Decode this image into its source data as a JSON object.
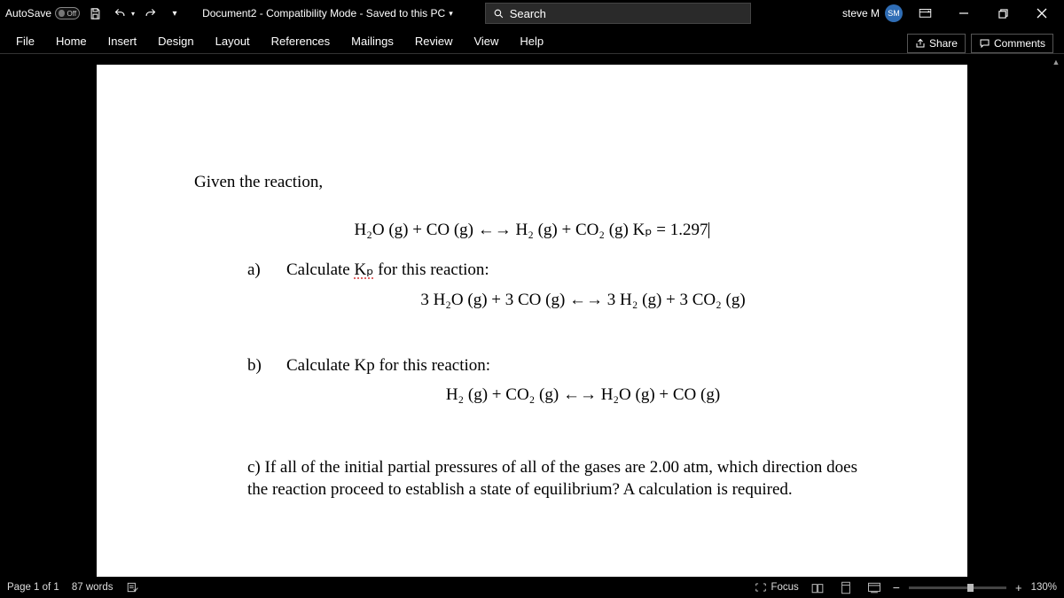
{
  "titlebar": {
    "autosave_label": "AutoSave",
    "autosave_state": "Off",
    "doc_title": "Document2 - Compatibility Mode - Saved to this PC",
    "search_placeholder": "Search",
    "user_name": "steve M",
    "user_initials": "SM"
  },
  "tabs": {
    "file": "File",
    "home": "Home",
    "insert": "Insert",
    "design": "Design",
    "layout": "Layout",
    "references": "References",
    "mailings": "Mailings",
    "review": "Review",
    "view": "View",
    "help": "Help",
    "share": "Share",
    "comments": "Comments"
  },
  "doc": {
    "intro": "Given the reaction,",
    "eq_main_pre": "H",
    "eq_main": "H₂O (g) + CO (g) ←→ H₂ (g) + CO₂ (g)   Kₚ = 1.297",
    "a_label": "a)",
    "a_text_pre": "Calculate ",
    "a_kp": "Kₚ",
    "a_text_post": " for this reaction:",
    "eq_a": "3 H₂O (g) + 3 CO (g) ←→ 3 H₂ (g) + 3 CO₂ (g)",
    "b_label": "b)",
    "b_text": "Calculate Kp for this reaction:",
    "eq_b": "H₂ (g) + CO₂ (g) ←→ H₂O (g) + CO (g)",
    "c_text": "c) If all of the initial partial pressures of all of the gases are 2.00 atm, which direction does the reaction proceed  to establish a state of equilibrium?  A calculation is required."
  },
  "status": {
    "page": "Page 1 of 1",
    "words": "87 words",
    "focus": "Focus",
    "zoom": "130%"
  }
}
